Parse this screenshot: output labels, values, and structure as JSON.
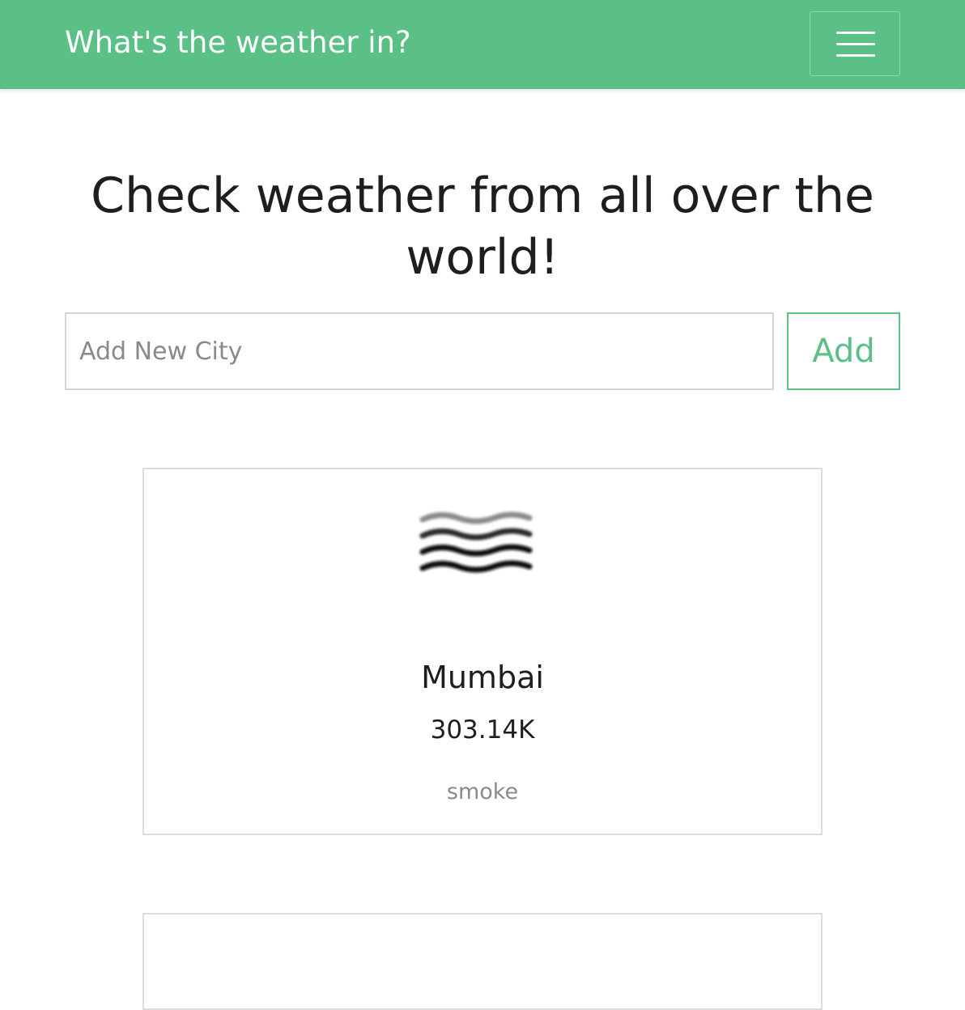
{
  "navbar": {
    "brand": "What's the weather in?",
    "menu_icon": "hamburger-menu-icon",
    "accent_color": "#5ac086"
  },
  "hero": {
    "title": "Check weather from all over the world!"
  },
  "search": {
    "placeholder": "Add New City",
    "value": "",
    "add_label": "Add"
  },
  "cards": [
    {
      "icon": "smoke-icon",
      "city": "Mumbai",
      "temperature": "303.14K",
      "description": "smoke"
    }
  ]
}
